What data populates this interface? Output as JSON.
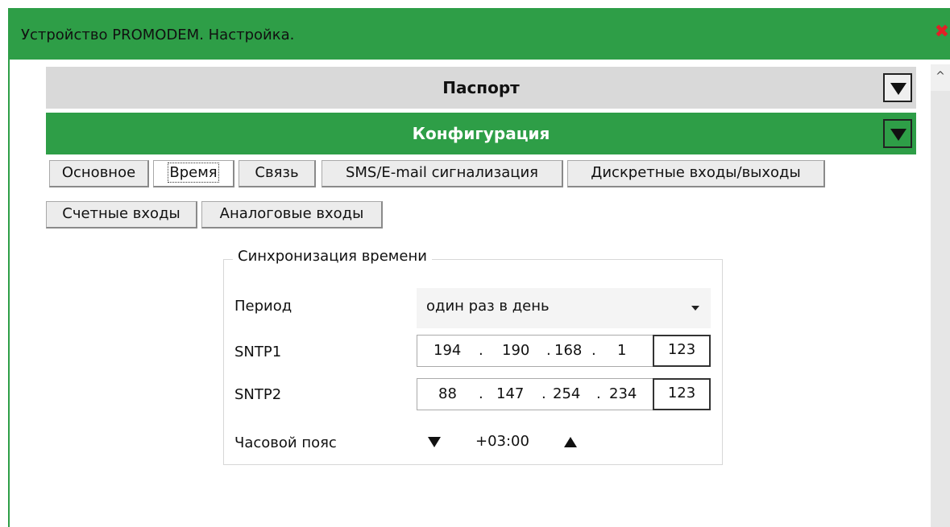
{
  "window": {
    "title": "Устройство PROMODEM. Настройка.",
    "close_icon": "close-x-icon",
    "accent_color": "#2e9e47",
    "close_color": "#e21f26"
  },
  "sections": {
    "passport": "Паспорт",
    "configuration": "Конфигурация"
  },
  "tabs": [
    {
      "label": "Основное"
    },
    {
      "label": "Время"
    },
    {
      "label": "Связь"
    },
    {
      "label": "SMS/E-mail  сигнализация"
    },
    {
      "label": "Дискретные входы/выходы"
    },
    {
      "label": "Счетные входы"
    },
    {
      "label": "Аналоговые входы"
    }
  ],
  "active_tab": "Время",
  "time_sync": {
    "group_title": "Синхронизация времени",
    "period_label": "Период",
    "period_value": "один раз в день",
    "sntp1_label": "SNTP1",
    "sntp1_octets": [
      "194",
      "190",
      "168",
      "1"
    ],
    "sntp2_label": "SNTP2",
    "sntp2_octets": [
      "88",
      "147",
      "254",
      "234"
    ],
    "ip_button_label": "123",
    "dot": ".",
    "timezone_label": "Часовой пояс",
    "timezone_value": "+03:00"
  }
}
